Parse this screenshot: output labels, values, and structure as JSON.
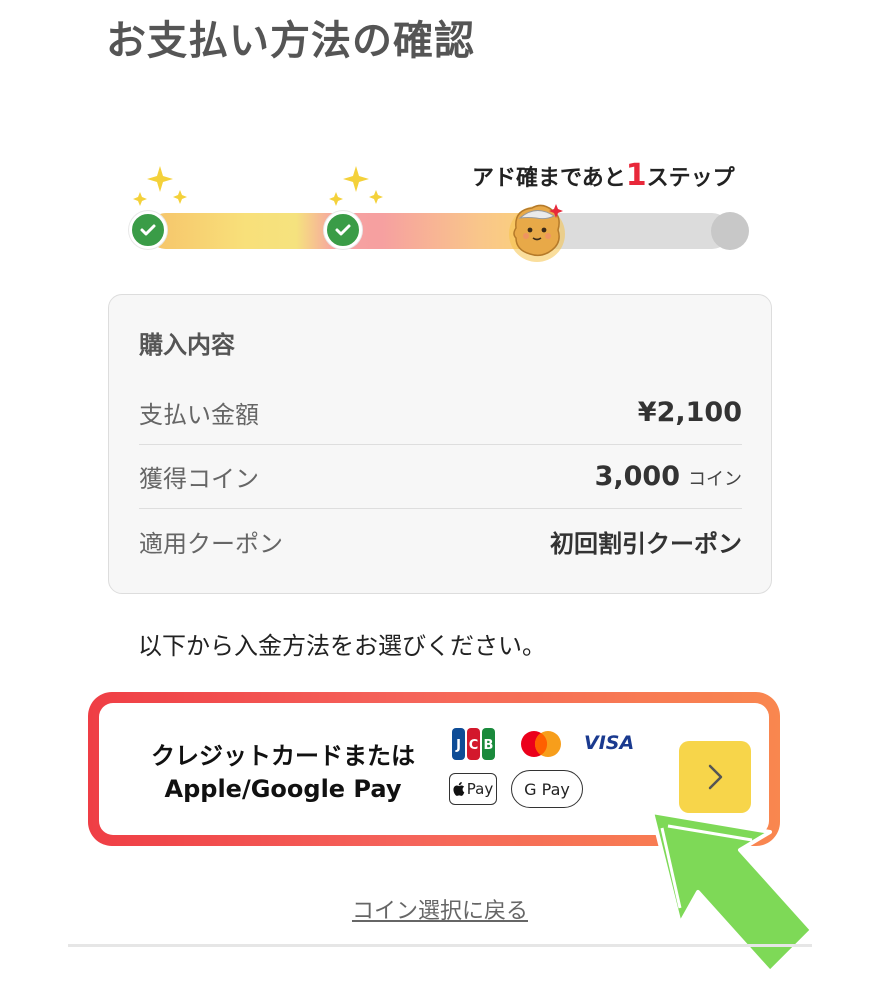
{
  "page": {
    "title": "お支払い方法の確認"
  },
  "progress": {
    "caption_prefix": "アド確まであと",
    "caption_number": "1",
    "caption_suffix": "ステップ",
    "steps_total": 4,
    "steps_completed": 2,
    "current_step": 3
  },
  "summary": {
    "title": "購入内容",
    "rows": [
      {
        "label": "支払い金額",
        "value": "¥2,100",
        "unit": ""
      },
      {
        "label": "獲得コイン",
        "value": "3,000",
        "unit": "コイン"
      },
      {
        "label": "適用クーポン",
        "value": "初回割引クーポン",
        "unit": ""
      }
    ]
  },
  "instruction": "以下から入金方法をお選びください。",
  "payment_option": {
    "label_line1": "クレジットカードまたは",
    "label_line2": "Apple/Google Pay",
    "brands": [
      "JCB",
      "VISA",
      "Pay",
      "G Pay"
    ],
    "icons": [
      "jcb-logo",
      "mastercard-logo",
      "visa-logo",
      "apple-pay-badge",
      "google-pay-badge",
      "chevron-right-icon"
    ]
  },
  "back_link": "コイン選択に戻る",
  "colors": {
    "accent_red": "#e8283a",
    "check_green": "#3a9c47",
    "button_yellow": "#f7d54a",
    "pointer_green": "#7ed957"
  }
}
